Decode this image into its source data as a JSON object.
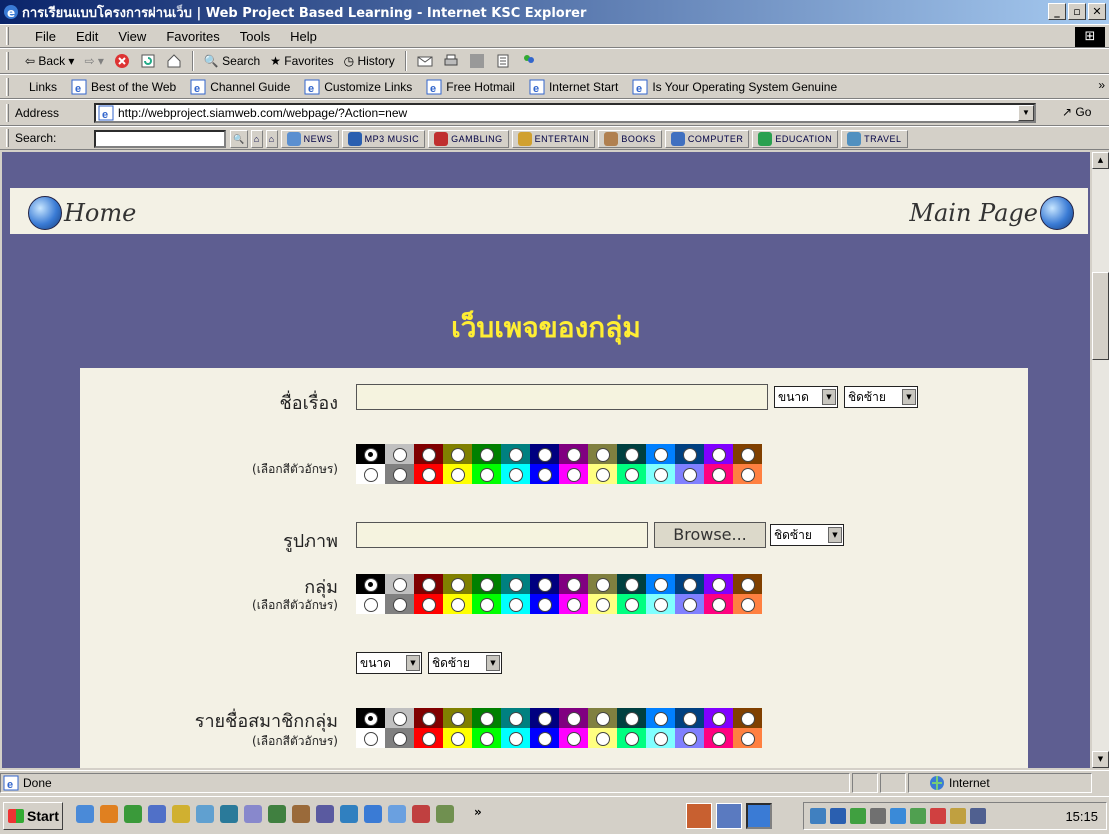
{
  "window": {
    "title": "การเรียนแบบโครงการผ่านเว็บ | Web Project Based Learning - Internet KSC Explorer",
    "controls": [
      "_",
      "▫",
      "✕"
    ]
  },
  "menu": [
    "File",
    "Edit",
    "View",
    "Favorites",
    "Tools",
    "Help"
  ],
  "toolbar": {
    "back": "Back",
    "search": "Search",
    "favorites": "Favorites",
    "history": "History"
  },
  "links": {
    "label": "Links",
    "items": [
      "Best of the Web",
      "Channel Guide",
      "Customize Links",
      "Free Hotmail",
      "Internet Start",
      "Is Your Operating System Genuine"
    ],
    "more": "»"
  },
  "address": {
    "label": "Address",
    "url": "http://webproject.siamweb.com/webpage/?Action=new",
    "go": "Go"
  },
  "searchbar": {
    "label": "Search:",
    "buttons": [
      "NEWS",
      "MP3 MUSIC",
      "GAMBLING",
      "ENTERTAIN",
      "BOOKS",
      "COMPUTER",
      "EDUCATION",
      "TRAVEL"
    ],
    "colors": [
      "#5a8fd0",
      "#2a5fb0",
      "#c03030",
      "#d0a030",
      "#b08050",
      "#4070c0",
      "#2aa050",
      "#5090c0"
    ]
  },
  "page": {
    "home": "Home",
    "main_page": "Main Page",
    "title": "เว็บเพจของกลุ่ม",
    "form": {
      "subject_label": "ชื่อเรื่อง",
      "color_hint": "(เลือกสีตัวอักษร)",
      "image_label": "รูปภาพ",
      "group_label": "กลุ่ม",
      "members_label": "รายชื่อสมาชิกกลุ่ม",
      "size_select": "ขนาด",
      "align_select": "ชิดซ้าย",
      "browse": "Browse...",
      "palette_colors": [
        "#000000",
        "#c0c0c0",
        "#800000",
        "#808000",
        "#008000",
        "#008080",
        "#000080",
        "#800080",
        "#808040",
        "#004040",
        "#0080ff",
        "#004080",
        "#8000ff",
        "#804000"
      ],
      "palette_colors_light": [
        "#ffffff",
        "#808080",
        "#ff0000",
        "#ffff00",
        "#00ff00",
        "#00ffff",
        "#0000ff",
        "#ff00ff",
        "#ffff80",
        "#00ff80",
        "#80ffff",
        "#8080ff",
        "#ff0080",
        "#ff8040"
      ]
    }
  },
  "status": {
    "text": "Done",
    "zone": "Internet"
  },
  "taskbar": {
    "start": "Start",
    "more": "»",
    "clock": "15:15"
  }
}
